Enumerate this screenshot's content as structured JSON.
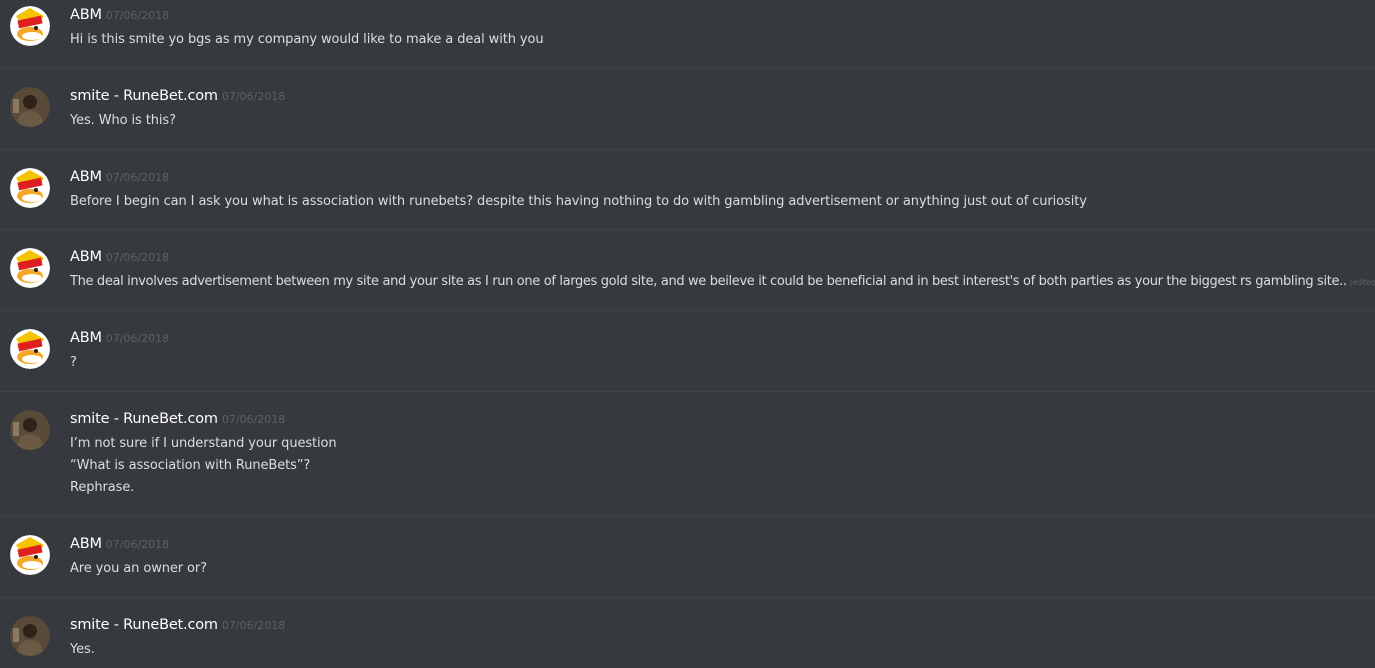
{
  "messages": [
    {
      "author": "ABM",
      "avatar": "duck-avatar",
      "timestamp": "07/06/2018",
      "lines": [
        "Hi is this smite yo bgs as my company would like to make a deal with you"
      ]
    },
    {
      "author": "smite - RuneBet.com",
      "avatar": "person-avatar",
      "timestamp": "07/06/2018",
      "lines": [
        "Yes. Who is this?"
      ]
    },
    {
      "author": "ABM",
      "avatar": "duck-avatar",
      "timestamp": "07/06/2018",
      "lines": [
        "Before I begin can I ask you what is association with runebets? despite this having nothing to do with gambling advertisement or anything just out of curiosity"
      ]
    },
    {
      "author": "ABM",
      "avatar": "duck-avatar",
      "timestamp": "07/06/2018",
      "lines": [
        "The deal involves advertisement between my site and your site as I run one of larges gold site, and we beileve it could be beneficial and in best interest's of both parties as your the biggest rs gambling site.."
      ],
      "edited": "(edited)"
    },
    {
      "author": "ABM",
      "avatar": "duck-avatar",
      "timestamp": "07/06/2018",
      "lines": [
        "?"
      ]
    },
    {
      "author": "smite - RuneBet.com",
      "avatar": "person-avatar",
      "timestamp": "07/06/2018",
      "lines": [
        "I’m not sure if I understand your question",
        "“What is association with RuneBets”?",
        "Rephrase."
      ]
    },
    {
      "author": "ABM",
      "avatar": "duck-avatar",
      "timestamp": "07/06/2018",
      "lines": [
        "Are you an owner or?"
      ]
    },
    {
      "author": "smite - RuneBet.com",
      "avatar": "person-avatar",
      "timestamp": "07/06/2018",
      "lines": [
        "Yes."
      ]
    }
  ]
}
